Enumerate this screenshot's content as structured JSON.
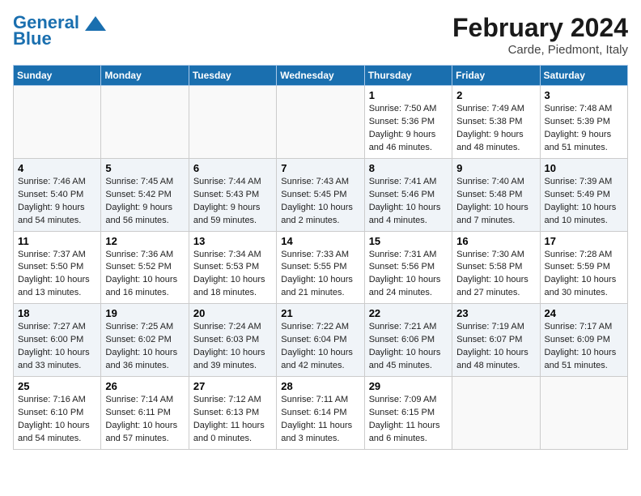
{
  "header": {
    "logo_line1": "General",
    "logo_line2": "Blue",
    "month": "February 2024",
    "location": "Carde, Piedmont, Italy"
  },
  "weekdays": [
    "Sunday",
    "Monday",
    "Tuesday",
    "Wednesday",
    "Thursday",
    "Friday",
    "Saturday"
  ],
  "weeks": [
    [
      {
        "day": "",
        "info": ""
      },
      {
        "day": "",
        "info": ""
      },
      {
        "day": "",
        "info": ""
      },
      {
        "day": "",
        "info": ""
      },
      {
        "day": "1",
        "info": "Sunrise: 7:50 AM\nSunset: 5:36 PM\nDaylight: 9 hours and 46 minutes."
      },
      {
        "day": "2",
        "info": "Sunrise: 7:49 AM\nSunset: 5:38 PM\nDaylight: 9 hours and 48 minutes."
      },
      {
        "day": "3",
        "info": "Sunrise: 7:48 AM\nSunset: 5:39 PM\nDaylight: 9 hours and 51 minutes."
      }
    ],
    [
      {
        "day": "4",
        "info": "Sunrise: 7:46 AM\nSunset: 5:40 PM\nDaylight: 9 hours and 54 minutes."
      },
      {
        "day": "5",
        "info": "Sunrise: 7:45 AM\nSunset: 5:42 PM\nDaylight: 9 hours and 56 minutes."
      },
      {
        "day": "6",
        "info": "Sunrise: 7:44 AM\nSunset: 5:43 PM\nDaylight: 9 hours and 59 minutes."
      },
      {
        "day": "7",
        "info": "Sunrise: 7:43 AM\nSunset: 5:45 PM\nDaylight: 10 hours and 2 minutes."
      },
      {
        "day": "8",
        "info": "Sunrise: 7:41 AM\nSunset: 5:46 PM\nDaylight: 10 hours and 4 minutes."
      },
      {
        "day": "9",
        "info": "Sunrise: 7:40 AM\nSunset: 5:48 PM\nDaylight: 10 hours and 7 minutes."
      },
      {
        "day": "10",
        "info": "Sunrise: 7:39 AM\nSunset: 5:49 PM\nDaylight: 10 hours and 10 minutes."
      }
    ],
    [
      {
        "day": "11",
        "info": "Sunrise: 7:37 AM\nSunset: 5:50 PM\nDaylight: 10 hours and 13 minutes."
      },
      {
        "day": "12",
        "info": "Sunrise: 7:36 AM\nSunset: 5:52 PM\nDaylight: 10 hours and 16 minutes."
      },
      {
        "day": "13",
        "info": "Sunrise: 7:34 AM\nSunset: 5:53 PM\nDaylight: 10 hours and 18 minutes."
      },
      {
        "day": "14",
        "info": "Sunrise: 7:33 AM\nSunset: 5:55 PM\nDaylight: 10 hours and 21 minutes."
      },
      {
        "day": "15",
        "info": "Sunrise: 7:31 AM\nSunset: 5:56 PM\nDaylight: 10 hours and 24 minutes."
      },
      {
        "day": "16",
        "info": "Sunrise: 7:30 AM\nSunset: 5:58 PM\nDaylight: 10 hours and 27 minutes."
      },
      {
        "day": "17",
        "info": "Sunrise: 7:28 AM\nSunset: 5:59 PM\nDaylight: 10 hours and 30 minutes."
      }
    ],
    [
      {
        "day": "18",
        "info": "Sunrise: 7:27 AM\nSunset: 6:00 PM\nDaylight: 10 hours and 33 minutes."
      },
      {
        "day": "19",
        "info": "Sunrise: 7:25 AM\nSunset: 6:02 PM\nDaylight: 10 hours and 36 minutes."
      },
      {
        "day": "20",
        "info": "Sunrise: 7:24 AM\nSunset: 6:03 PM\nDaylight: 10 hours and 39 minutes."
      },
      {
        "day": "21",
        "info": "Sunrise: 7:22 AM\nSunset: 6:04 PM\nDaylight: 10 hours and 42 minutes."
      },
      {
        "day": "22",
        "info": "Sunrise: 7:21 AM\nSunset: 6:06 PM\nDaylight: 10 hours and 45 minutes."
      },
      {
        "day": "23",
        "info": "Sunrise: 7:19 AM\nSunset: 6:07 PM\nDaylight: 10 hours and 48 minutes."
      },
      {
        "day": "24",
        "info": "Sunrise: 7:17 AM\nSunset: 6:09 PM\nDaylight: 10 hours and 51 minutes."
      }
    ],
    [
      {
        "day": "25",
        "info": "Sunrise: 7:16 AM\nSunset: 6:10 PM\nDaylight: 10 hours and 54 minutes."
      },
      {
        "day": "26",
        "info": "Sunrise: 7:14 AM\nSunset: 6:11 PM\nDaylight: 10 hours and 57 minutes."
      },
      {
        "day": "27",
        "info": "Sunrise: 7:12 AM\nSunset: 6:13 PM\nDaylight: 11 hours and 0 minutes."
      },
      {
        "day": "28",
        "info": "Sunrise: 7:11 AM\nSunset: 6:14 PM\nDaylight: 11 hours and 3 minutes."
      },
      {
        "day": "29",
        "info": "Sunrise: 7:09 AM\nSunset: 6:15 PM\nDaylight: 11 hours and 6 minutes."
      },
      {
        "day": "",
        "info": ""
      },
      {
        "day": "",
        "info": ""
      }
    ]
  ]
}
